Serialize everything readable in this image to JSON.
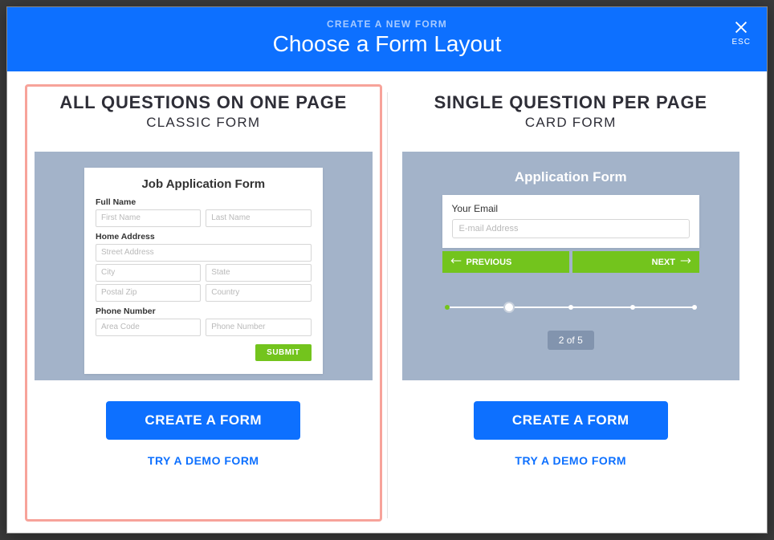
{
  "header": {
    "eyebrow": "CREATE A NEW FORM",
    "title": "Choose a Form Layout",
    "close_label": "ESC"
  },
  "left": {
    "heading": "ALL QUESTIONS ON ONE PAGE",
    "subtitle": "CLASSIC FORM",
    "create_label": "CREATE A FORM",
    "demo_label": "TRY A DEMO FORM",
    "selected": true,
    "preview": {
      "title": "Job Application Form",
      "full_name_label": "Full Name",
      "first_name_ph": "First Name",
      "last_name_ph": "Last Name",
      "home_address_label": "Home Address",
      "street_ph": "Street Address",
      "city_ph": "City",
      "state_ph": "State",
      "postal_ph": "Postal Zip",
      "country_ph": "Country",
      "phone_label": "Phone Number",
      "area_ph": "Area Code",
      "phone_ph": "Phone Number",
      "submit_label": "SUBMIT"
    }
  },
  "right": {
    "heading": "SINGLE QUESTION PER PAGE",
    "subtitle": "CARD FORM",
    "create_label": "CREATE A FORM",
    "demo_label": "TRY A DEMO FORM",
    "preview": {
      "title": "Application Form",
      "field_label": "Your Email",
      "field_ph": "E-mail Address",
      "prev_label": "PREVIOUS",
      "next_label": "NEXT",
      "pager": "2 of 5"
    }
  }
}
